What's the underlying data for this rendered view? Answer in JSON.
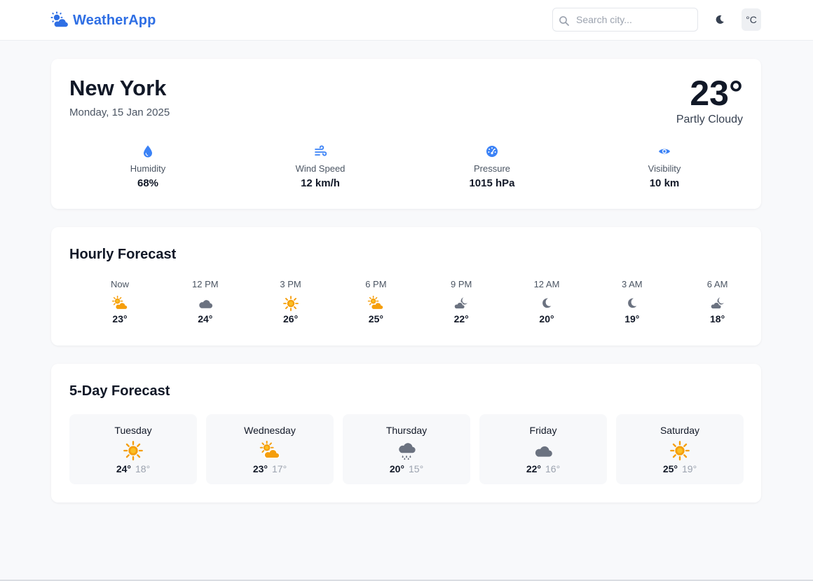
{
  "app": {
    "name": "WeatherApp",
    "logo_icon": "sun-cloud-icon"
  },
  "colors": {
    "brand": "#2f6fe4",
    "sun": "#f59e0b",
    "cloud": "#6b7280",
    "moon": "#6b7280"
  },
  "header": {
    "search_placeholder": "Search city...",
    "search_value": "",
    "theme_toggle_icon": "moon-icon",
    "unit_label": "°C"
  },
  "current": {
    "city": "New York",
    "date": "Monday, 15 Jan 2025",
    "temperature": "23°",
    "condition": "Partly Cloudy",
    "stats": [
      {
        "icon": "droplet-icon",
        "label": "Humidity",
        "value": "68%"
      },
      {
        "icon": "wind-icon",
        "label": "Wind Speed",
        "value": "12 km/h"
      },
      {
        "icon": "gauge-icon",
        "label": "Pressure",
        "value": "1015 hPa"
      },
      {
        "icon": "eye-icon",
        "label": "Visibility",
        "value": "10 km"
      }
    ]
  },
  "hourly": {
    "title": "Hourly Forecast",
    "items": [
      {
        "time": "Now",
        "icon": "sun-cloud-icon",
        "temp": "23°"
      },
      {
        "time": "12 PM",
        "icon": "cloud-icon",
        "temp": "24°"
      },
      {
        "time": "3 PM",
        "icon": "sun-icon",
        "temp": "26°"
      },
      {
        "time": "6 PM",
        "icon": "sun-cloud-icon",
        "temp": "25°"
      },
      {
        "time": "9 PM",
        "icon": "moon-cloud-icon",
        "temp": "22°"
      },
      {
        "time": "12 AM",
        "icon": "moon-icon",
        "temp": "20°"
      },
      {
        "time": "3 AM",
        "icon": "moon-icon",
        "temp": "19°"
      },
      {
        "time": "6 AM",
        "icon": "moon-cloud-icon",
        "temp": "18°"
      }
    ]
  },
  "daily": {
    "title": "5-Day Forecast",
    "items": [
      {
        "day": "Tuesday",
        "icon": "sun-icon",
        "high": "24°",
        "low": "18°"
      },
      {
        "day": "Wednesday",
        "icon": "sun-cloud-icon",
        "high": "23°",
        "low": "17°"
      },
      {
        "day": "Thursday",
        "icon": "rain-cloud-icon",
        "high": "20°",
        "low": "15°"
      },
      {
        "day": "Friday",
        "icon": "cloud-icon",
        "high": "22°",
        "low": "16°"
      },
      {
        "day": "Saturday",
        "icon": "sun-icon",
        "high": "25°",
        "low": "19°"
      }
    ]
  }
}
